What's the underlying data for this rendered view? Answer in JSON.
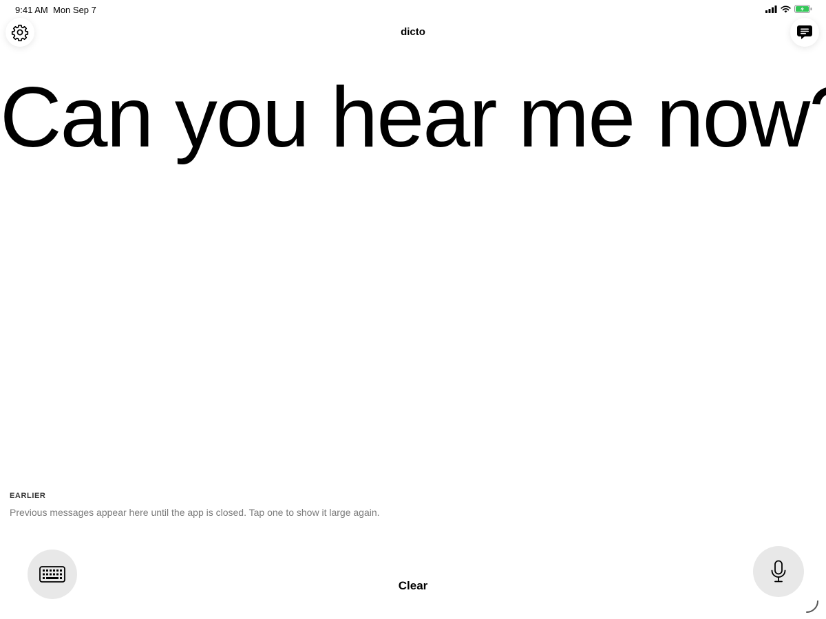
{
  "status_bar": {
    "time": "9:41 AM",
    "date": "Mon Sep 7",
    "battery_color": "#34c759"
  },
  "header": {
    "title": "dicto",
    "left_icon": "gear-icon",
    "right_icon": "message-icon"
  },
  "main": {
    "message": "Can you hear me now?"
  },
  "earlier": {
    "heading": "EARLIER",
    "hint": "Previous messages appear here until the app is closed. Tap one to show it large again."
  },
  "controls": {
    "keyboard_icon": "keyboard-icon",
    "clear_label": "Clear",
    "mic_icon": "microphone-icon"
  }
}
